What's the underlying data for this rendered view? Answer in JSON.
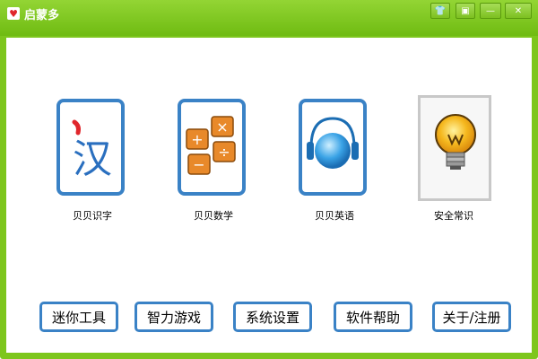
{
  "window": {
    "title": "启蒙多",
    "accent": "#7dc61d",
    "frame_blue": "#3a82c6"
  },
  "title_buttons": [
    {
      "name": "skin",
      "icon": "shirt-icon",
      "glyph": "👕"
    },
    {
      "name": "pin",
      "icon": "window-icon",
      "glyph": "▣"
    },
    {
      "name": "minimize",
      "icon": "minimize-icon",
      "glyph": "—"
    },
    {
      "name": "close",
      "icon": "close-icon",
      "glyph": "✕"
    }
  ],
  "modules": [
    {
      "label": "贝贝识字",
      "icon": "chinese-character-icon",
      "glyph": "汉"
    },
    {
      "label": "贝贝数学",
      "icon": "math-blocks-icon"
    },
    {
      "label": "贝贝英语",
      "icon": "headphones-icon"
    },
    {
      "label": "安全常识",
      "icon": "lightbulb-icon"
    }
  ],
  "actions": [
    {
      "label": "迷你工具"
    },
    {
      "label": "智力游戏"
    },
    {
      "label": "系统设置"
    },
    {
      "label": "软件帮助"
    },
    {
      "label": "关于/注册"
    }
  ]
}
